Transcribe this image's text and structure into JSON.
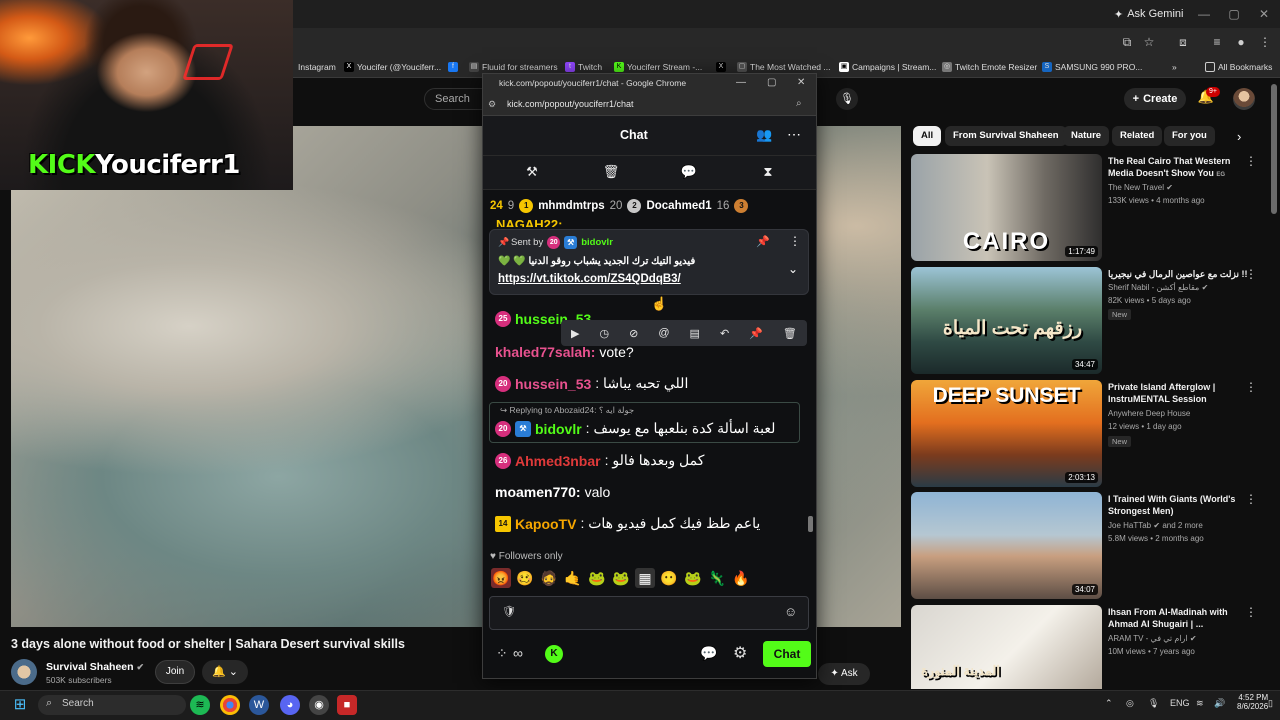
{
  "browser": {
    "gemini_label": "Ask Gemini",
    "bookmarks": [
      "Instagram",
      "Youcifer (@Youciferr...",
      "Fluuid for streamers",
      "Twitch",
      "Youciferr Stream -...",
      "The Most Watched ...",
      "Campaigns | Stream...",
      "Twitch Emote Resizer",
      "SAMSUNG 990 PRO..."
    ],
    "all_bookmarks": "All Bookmarks"
  },
  "youtube": {
    "search_placeholder": "Search",
    "create_label": "Create",
    "notif_badge": "9+",
    "video_title": "3 days alone without food or shelter | Sahara Desert survival skills",
    "channel_name": "Survival Shaheen",
    "subscribers": "503K subscribers",
    "join_label": "Join",
    "ask_label": "Ask",
    "chips": [
      "All",
      "From Survival Shaheen",
      "Nature",
      "Related",
      "For you"
    ],
    "recommendations": [
      {
        "title": "The Real Cairo That Western Media Doesn't Show You",
        "title_suffix": "EG",
        "channel": "The New Travel",
        "meta": "133K views • 4 months ago",
        "duration": "1:17:49",
        "thumb_text": "CAIRO",
        "new": ""
      },
      {
        "title": "!! نزلت مع عواصين الرمال في نيجيريا",
        "title_suffix": "",
        "channel": "Sherif Nabil - مقاطع أكشن",
        "meta": "82K views • 5 days ago",
        "duration": "34:47",
        "thumb_text": "رزقهم تحت المياة",
        "new": "New"
      },
      {
        "title": "Private Island Afterglow | InstruMENTAL Session",
        "title_suffix": "",
        "channel": "Anywhere Deep House",
        "meta": "12 views • 1 day ago",
        "duration": "2:03:13",
        "thumb_text": "DEEP SUNSET",
        "new": "New"
      },
      {
        "title": "I Trained With Giants (World's Strongest Men)",
        "title_suffix": "",
        "channel": "Joe HaTTab",
        "channel_extra": "and 2 more",
        "meta": "5.8M views • 2 months ago",
        "duration": "34:07",
        "thumb_text": "",
        "new": ""
      },
      {
        "title": "Ihsan From Al-Madinah with Ahmad Al Shugairi | ...",
        "title_suffix": "",
        "channel": "ARAM TV - ارام تي في",
        "meta": "10M views • 7 years ago",
        "duration": "",
        "thumb_text": "المدينة المنورة",
        "new": ""
      }
    ]
  },
  "stream_overlay": {
    "kick_text": "KICK",
    "username": "Youciferr1"
  },
  "popup": {
    "window_title": "kick.com/popout/youciferr1/chat - Google Chrome",
    "address": "kick.com/popout/youciferr1/chat",
    "chat_title": "Chat",
    "leaderboard": [
      {
        "name": "mhmdmtrps",
        "count": "20",
        "rank": "1"
      },
      {
        "name": "Docahmed1",
        "count": "16",
        "rank": "2"
      },
      {
        "name": "",
        "count": "",
        "rank": "3"
      }
    ],
    "leader_prefix_count": "9",
    "leader_prefix_name": "24",
    "partial_user": "NAGAH22:",
    "pinned": {
      "sent_by": "Sent by",
      "author": "bidovlr",
      "author_badge": "20",
      "message": "فيديو التيك ترك الجديد يشباب روقو الدنيا 💚 💚",
      "link": "https://vt.tiktok.com/ZS4QDdqB3/"
    },
    "messages": [
      {
        "badge": "25",
        "user": "hussein_53",
        "text": "...",
        "user_color": "#d62f7d"
      },
      {
        "badge": "",
        "user": "khaled77salah:",
        "text": "vote?",
        "user_color": "#e8528f"
      },
      {
        "badge": "20",
        "user": "hussein_53",
        "text": ": اللي تحبه يباشا",
        "user_color": "#d62f7d"
      },
      {
        "badge": "20",
        "user": "bidovlr",
        "text": ": لعبة اسألة كدة بنلعبها مع يوسف",
        "user_color": "#53fc18"
      },
      {
        "badge": "26",
        "user": "Ahmed3nbar",
        "text": ": كمل وبعدها فالو",
        "user_color": "#e03a3a"
      },
      {
        "badge": "",
        "user": "moamen770:",
        "text": "valo",
        "user_color": "#ffffff"
      },
      {
        "badge": "14",
        "user": "KapooTV",
        "text": ": ياعم طظ فيك كمل فيديو هات",
        "user_color": "#f6c600"
      }
    ],
    "reply_header": "Replying to Abozaid24: جولة ايه ؟",
    "followers_only": "Followers only",
    "chat_button": "Chat"
  },
  "taskbar": {
    "search": "Search",
    "lang": "ENG",
    "time": "4:52 PM",
    "date": "8/6/2026"
  }
}
